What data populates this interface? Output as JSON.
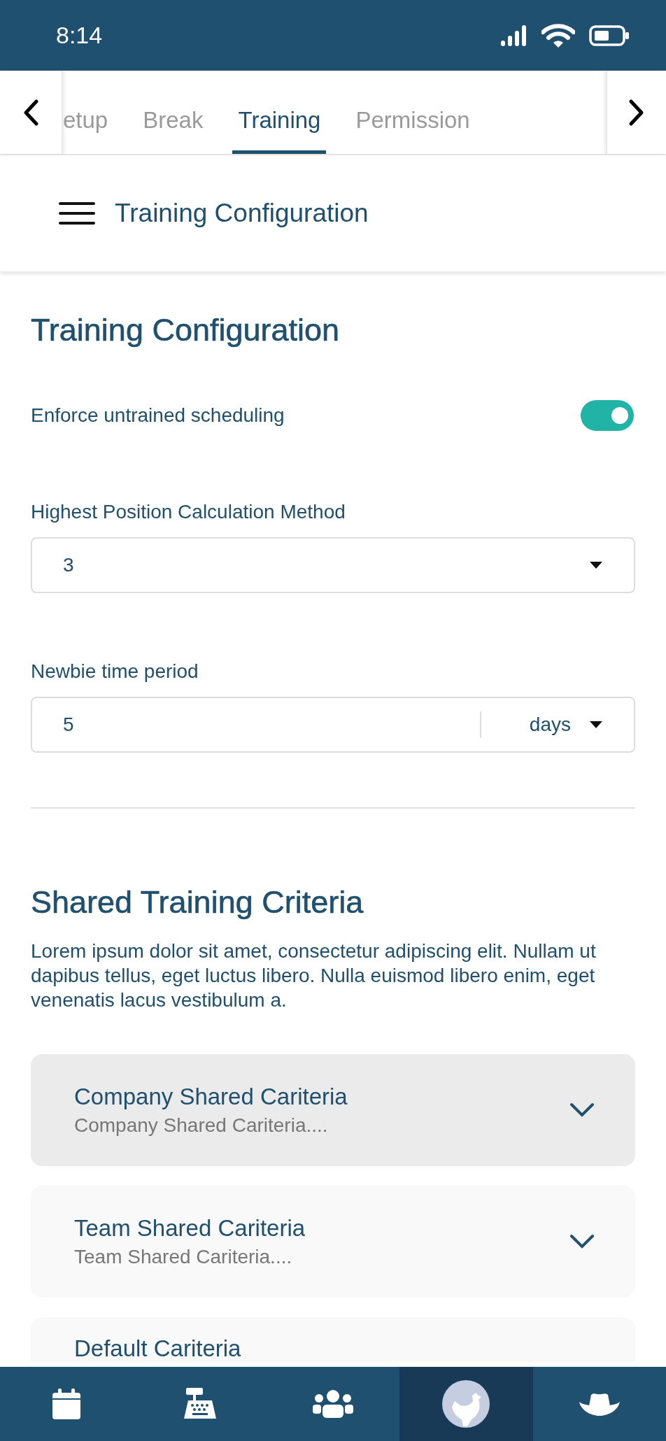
{
  "status_bar": {
    "time": "8:14"
  },
  "tabs": [
    {
      "label": "etup",
      "selected": false
    },
    {
      "label": "Break",
      "selected": false
    },
    {
      "label": "Training",
      "selected": true
    },
    {
      "label": "Permission",
      "selected": false
    }
  ],
  "header": {
    "title": "Training Configuration"
  },
  "section": {
    "title": "Training Configuration",
    "toggle": {
      "label": "Enforce untrained scheduling",
      "on": true
    },
    "method": {
      "label": "Highest Position Calculation Method",
      "value": "3"
    },
    "newbie": {
      "label": "Newbie time period",
      "value": "5",
      "unit": "days"
    }
  },
  "shared": {
    "title": "Shared Training Criteria",
    "description": "Lorem ipsum dolor sit amet, consectetur adipiscing elit. Nullam ut dapibus tellus, eget luctus libero. Nulla euismod libero enim, eget venenatis lacus vestibulum a.",
    "items": [
      {
        "title": "Company Shared Cariteria",
        "subtitle": "Company Shared Cariteria....",
        "selected": true
      },
      {
        "title": "Team Shared Cariteria",
        "subtitle": "Team Shared Cariteria....",
        "selected": false
      },
      {
        "title": "Default Cariteria",
        "selected": false
      }
    ]
  },
  "bottom_nav": [
    {
      "kind": "calendar",
      "selected": false
    },
    {
      "kind": "register",
      "selected": false
    },
    {
      "kind": "people",
      "selected": false
    },
    {
      "kind": "avatar",
      "selected": true
    },
    {
      "kind": "hat",
      "selected": false
    }
  ]
}
